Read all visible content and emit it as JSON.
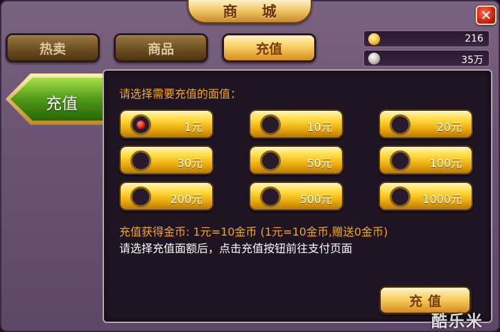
{
  "title": "商 城",
  "close_symbol": "✕",
  "tabs": [
    {
      "label": "热卖",
      "active": false
    },
    {
      "label": "商品",
      "active": false
    },
    {
      "label": "充值",
      "active": true
    }
  ],
  "currency": {
    "gold": {
      "icon": "gold-coin-icon",
      "value": "216"
    },
    "silver": {
      "icon": "silver-coin-icon",
      "value": "35万"
    }
  },
  "side_tab": {
    "label": "充值"
  },
  "prompt": "请选择需要充值的面值：",
  "amounts": [
    {
      "label": "1元",
      "selected": true
    },
    {
      "label": "10元",
      "selected": false
    },
    {
      "label": "20元",
      "selected": false
    },
    {
      "label": "30元",
      "selected": false
    },
    {
      "label": "50元",
      "selected": false
    },
    {
      "label": "100元",
      "selected": false
    },
    {
      "label": "200元",
      "selected": false
    },
    {
      "label": "500元",
      "selected": false
    },
    {
      "label": "1000元",
      "selected": false
    }
  ],
  "info_rate": "充值获得金币: 1元=10金币 (1元=10金币,赠送0金币)",
  "info_hint": "请选择充值面额后，点击充值按钮前往支付页面",
  "recharge_button": "充值",
  "watermark": "酷乐米",
  "colors": {
    "accent_orange": "#f5a623",
    "gold_button": "#f8cf62",
    "panel_bg": "#1f1422",
    "frame": "#6c5474",
    "side_tab_green": "#3f8a12"
  }
}
